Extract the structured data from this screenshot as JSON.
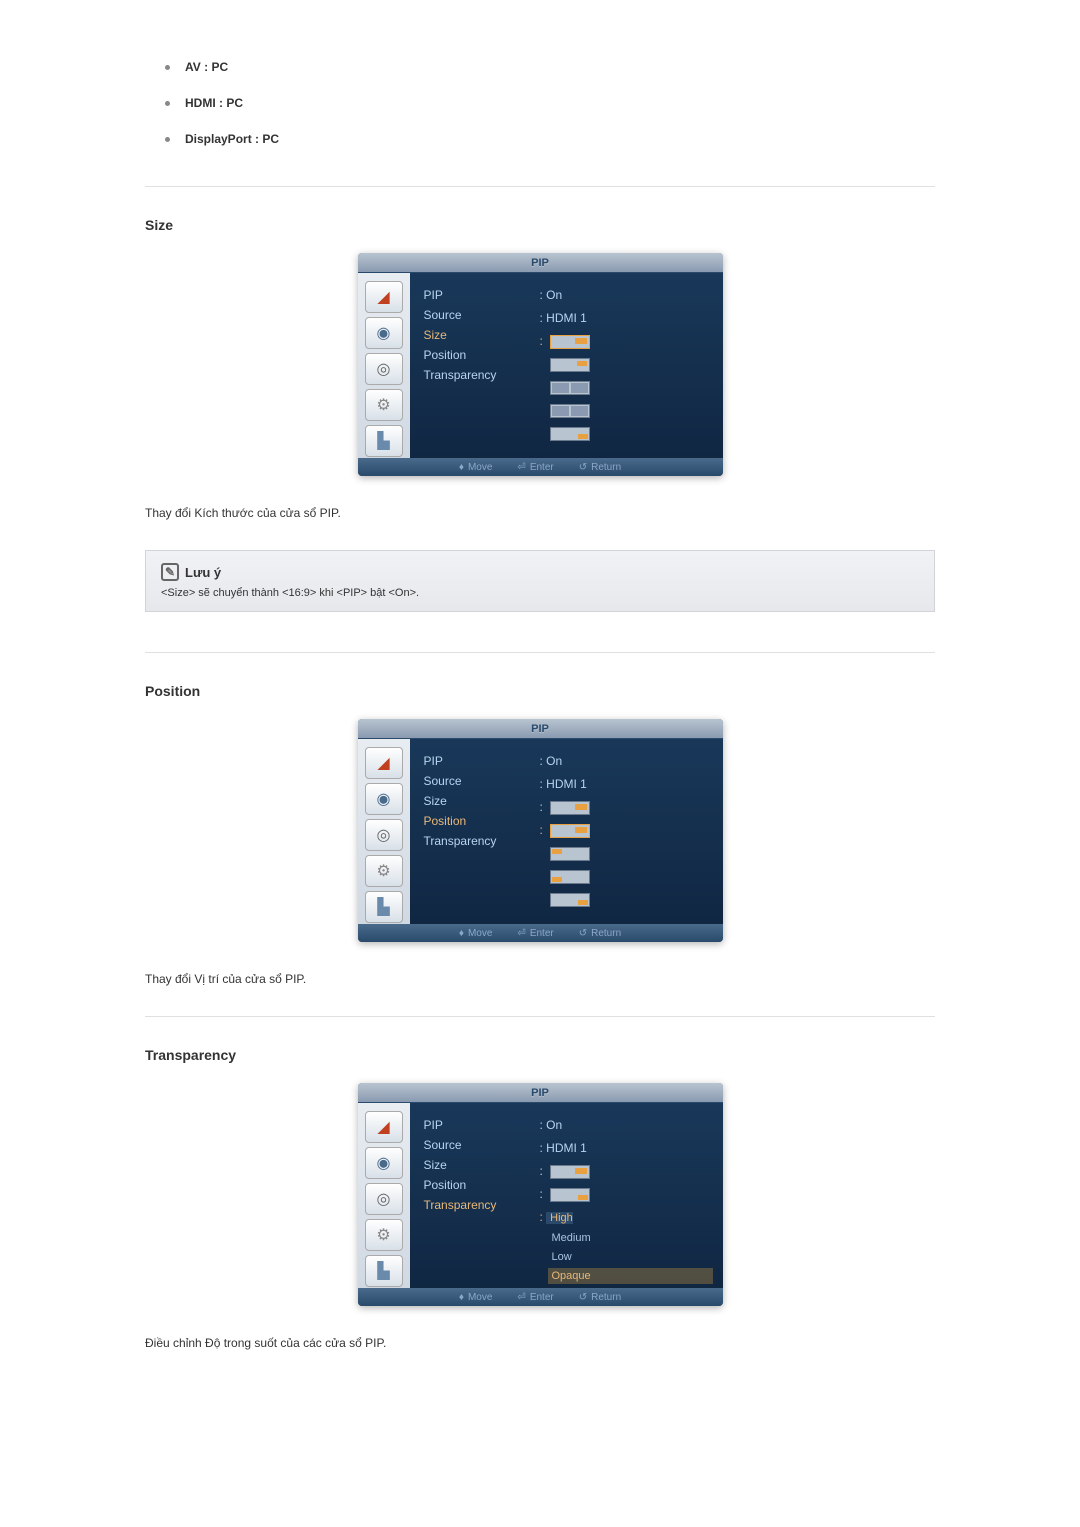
{
  "bullets": [
    {
      "text": "AV : PC"
    },
    {
      "text": "HDMI : PC"
    },
    {
      "text": "DisplayPort : PC"
    }
  ],
  "sections": {
    "size": {
      "header": "Size",
      "description": "Thay đổi Kích thước của cửa sổ PIP."
    },
    "position": {
      "header": "Position",
      "description": "Thay đổi Vị trí của cửa sổ PIP."
    },
    "transparency": {
      "header": "Transparency",
      "description": "Điều chỉnh Độ trong suốt của các cửa sổ PIP."
    }
  },
  "osd": {
    "title": "PIP",
    "menu_items": {
      "pip": "PIP",
      "source": "Source",
      "size": "Size",
      "position": "Position",
      "transparency": "Transparency"
    },
    "values": {
      "on": ": On",
      "hdmi1": ": HDMI 1",
      "colon": ":",
      "high": "High",
      "medium": "Medium",
      "low": "Low",
      "opaque": "Opaque"
    },
    "footer": {
      "move": "Move",
      "enter": "Enter",
      "return": "Return"
    }
  },
  "note": {
    "title": "Lưu ý",
    "body": "<Size> sẽ chuyển thành <16:9> khi <PIP> bật <On>."
  }
}
